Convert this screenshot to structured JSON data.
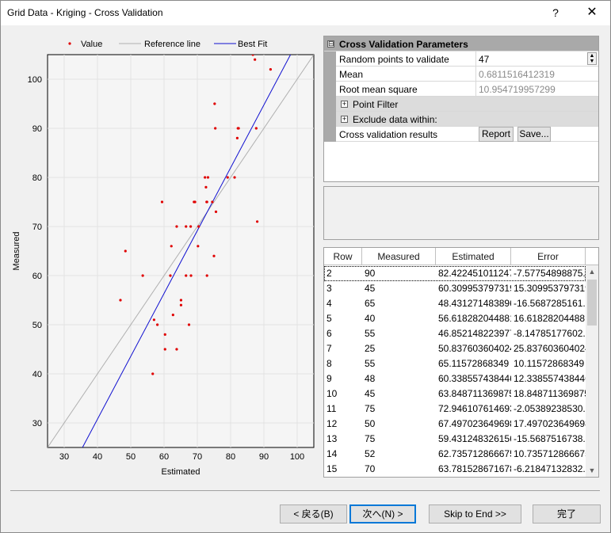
{
  "window": {
    "title": "Grid Data - Kriging - Cross Validation",
    "help_label": "?",
    "close_label": "✕"
  },
  "params": {
    "section_title": "Cross Validation Parameters",
    "section_toggle": "⊟",
    "random_points_label": "Random points to validate",
    "random_points_value": "47",
    "mean_label": "Mean",
    "mean_value": "0.6811516412319",
    "rms_label": "Root mean square",
    "rms_value": "10.954719957299",
    "point_filter_label": "Point Filter",
    "exclude_label": "Exclude data within:",
    "results_label": "Cross validation results",
    "report_label": "Report",
    "save_label": "Save..."
  },
  "table": {
    "columns": [
      "Row",
      "Measured",
      "Estimated",
      "Error"
    ],
    "rows": [
      [
        "2",
        "90",
        "82.422451011247",
        "-7.57754898875..."
      ],
      [
        "3",
        "45",
        "60.309953797319",
        "15.309953797319"
      ],
      [
        "4",
        "65",
        "48.431271483896",
        "-16.5687285161..."
      ],
      [
        "5",
        "40",
        "56.618282044881",
        "16.618282044881"
      ],
      [
        "6",
        "55",
        "46.852148223977",
        "-8.14785177602..."
      ],
      [
        "7",
        "25",
        "50.837603604024",
        "25.837603604024"
      ],
      [
        "8",
        "55",
        "65.11572868349",
        "10.11572868349"
      ],
      [
        "9",
        "48",
        "60.338557438446",
        "12.338557438446"
      ],
      [
        "10",
        "45",
        "63.848711369875",
        "18.848711369875"
      ],
      [
        "11",
        "75",
        "72.946107614693",
        "-2.05389238530..."
      ],
      [
        "12",
        "50",
        "67.497023649698",
        "17.497023649698"
      ],
      [
        "13",
        "75",
        "59.431248326156",
        "-15.5687516738..."
      ],
      [
        "14",
        "52",
        "62.735712866675",
        "10.735712866675"
      ],
      [
        "15",
        "70",
        "63.781528671678",
        "-6.21847132832..."
      ]
    ]
  },
  "buttons": {
    "back": "< 戻る(B)",
    "next": "次へ(N) >",
    "skip": "Skip to End >>",
    "finish": "完了"
  },
  "chart_data": {
    "type": "scatter",
    "xlabel": "Estimated",
    "ylabel": "Measured",
    "xlim": [
      25,
      105
    ],
    "ylim": [
      25,
      105
    ],
    "xticks": [
      30,
      40,
      50,
      60,
      70,
      80,
      90,
      100
    ],
    "yticks": [
      30,
      40,
      50,
      60,
      70,
      80,
      90,
      100
    ],
    "grid": true,
    "legend": {
      "position": "top",
      "entries": [
        {
          "label": "Value",
          "marker": "dot",
          "color": "#e00000"
        },
        {
          "label": "Reference line",
          "marker": "line",
          "color": "#b0b0b0"
        },
        {
          "label": "Best Fit",
          "marker": "line",
          "color": "#1010d0"
        }
      ]
    },
    "reference_line": {
      "slope": 1,
      "intercept": 0
    },
    "best_fit": {
      "from": [
        35.5,
        25
      ],
      "to": [
        98,
        105
      ]
    },
    "series": [
      {
        "name": "Value",
        "color": "#e00000",
        "points": [
          [
            82.4,
            90
          ],
          [
            60.3,
            45
          ],
          [
            48.4,
            65
          ],
          [
            56.6,
            40
          ],
          [
            46.9,
            55
          ],
          [
            65.1,
            55
          ],
          [
            60.3,
            48
          ],
          [
            63.8,
            45
          ],
          [
            72.9,
            75
          ],
          [
            67.5,
            50
          ],
          [
            59.4,
            75
          ],
          [
            62.7,
            52
          ],
          [
            63.8,
            70
          ],
          [
            86.7,
            105
          ],
          [
            87.3,
            104
          ],
          [
            92.0,
            102
          ],
          [
            75.2,
            95
          ],
          [
            75.4,
            90
          ],
          [
            82.2,
            90
          ],
          [
            87.7,
            90
          ],
          [
            82.0,
            88
          ],
          [
            72.3,
            80
          ],
          [
            73.2,
            80
          ],
          [
            79.1,
            80
          ],
          [
            81.2,
            80
          ],
          [
            72.6,
            78
          ],
          [
            69.0,
            75
          ],
          [
            69.3,
            75
          ],
          [
            72.8,
            75
          ],
          [
            74.5,
            75
          ],
          [
            75.6,
            73
          ],
          [
            88.0,
            71
          ],
          [
            66.6,
            70
          ],
          [
            68.0,
            70
          ],
          [
            70.4,
            70
          ],
          [
            70.2,
            66
          ],
          [
            62.2,
            66
          ],
          [
            75.0,
            64
          ],
          [
            53.6,
            60
          ],
          [
            61.9,
            60
          ],
          [
            66.6,
            60
          ],
          [
            68.1,
            60
          ],
          [
            72.9,
            60
          ],
          [
            65.1,
            54
          ],
          [
            57.0,
            51
          ],
          [
            58.0,
            50
          ]
        ]
      }
    ]
  }
}
